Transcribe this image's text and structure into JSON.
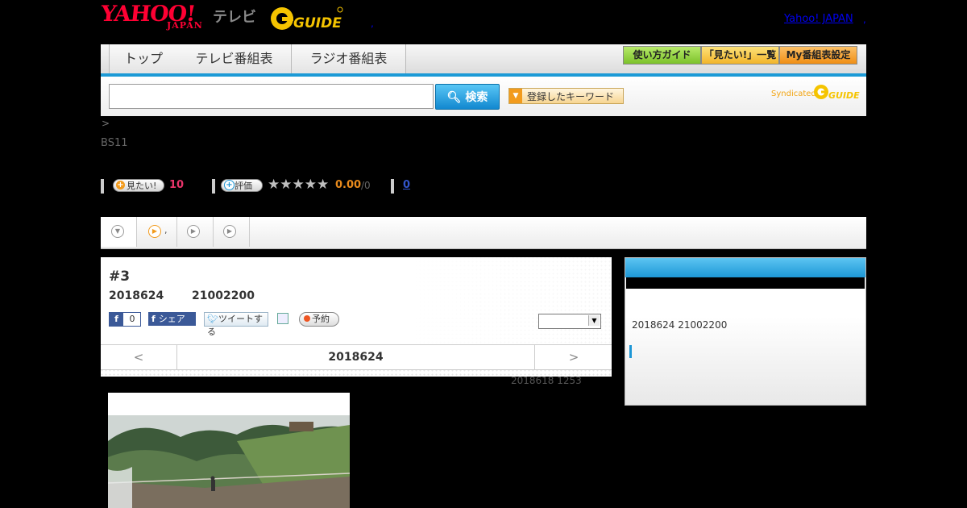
{
  "header": {
    "logo_yahoo": "YAHOO!",
    "logo_japan": "JAPAN",
    "logo_tv": "テレビ",
    "logo_gguide": "G GUIDE",
    "link_yahoo_japan": "Yahoo! JAPAN",
    "link_sep": ",",
    "logo_sep": ","
  },
  "nav": {
    "tabs": [
      {
        "label": "トップ"
      },
      {
        "label": "テレビ番組表"
      },
      {
        "label": "ラジオ番組表"
      }
    ],
    "buttons": [
      {
        "label": "使い方ガイド",
        "color": "#8fd13a"
      },
      {
        "label": "「見たい!」一覧",
        "color": "#f5c23c"
      },
      {
        "label": "My番組表設定",
        "color": "#f4a21c"
      }
    ]
  },
  "search": {
    "input_value": "",
    "button_label": "検索",
    "keyword_button": "登録したキーワード",
    "syndicated": "Syndicated"
  },
  "breadcrumb": ">",
  "channel": "BS11",
  "stats": {
    "want_label": "見たい!",
    "want_count": "10",
    "rate_label": "評価",
    "stars": "★★★★★",
    "rating": "0.00",
    "rating_of": "/0",
    "reviews": "0"
  },
  "program": {
    "title": "#3",
    "date": "2018624",
    "time": "21002200",
    "fb_count": "0",
    "fb_share": "シェア",
    "tweet": "ツイートする",
    "record": "予約",
    "nav_prev": "<",
    "nav_date": "2018624",
    "nav_next": ">"
  },
  "updated": "2018618  1253",
  "sidebar": {
    "text": "2018624  21002200"
  },
  "colors": {
    "accent": "#1d97d6",
    "brand_red": "#ff0033",
    "gguide_yellow": "#f5c400"
  }
}
